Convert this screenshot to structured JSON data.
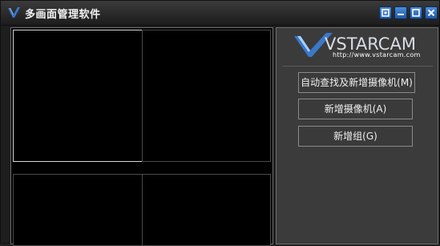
{
  "window": {
    "title": "多画面管理软件",
    "controls": [
      "restore-icon",
      "minimize-icon",
      "maximize-icon",
      "close-icon"
    ]
  },
  "brand": {
    "logo_text": "VSTARCAM",
    "url": "http://www.vstarcam.com"
  },
  "actions": {
    "auto_search": "自动查找及新增摄像机(M)",
    "add_camera": "新增摄像机(A)",
    "add_group": "新增组(G)"
  },
  "colors": {
    "titlebar": "#2a2a2a",
    "video_bg": "#000000",
    "panel_bg": "#3b3b3b",
    "control_blue": "#2f6fc1"
  }
}
